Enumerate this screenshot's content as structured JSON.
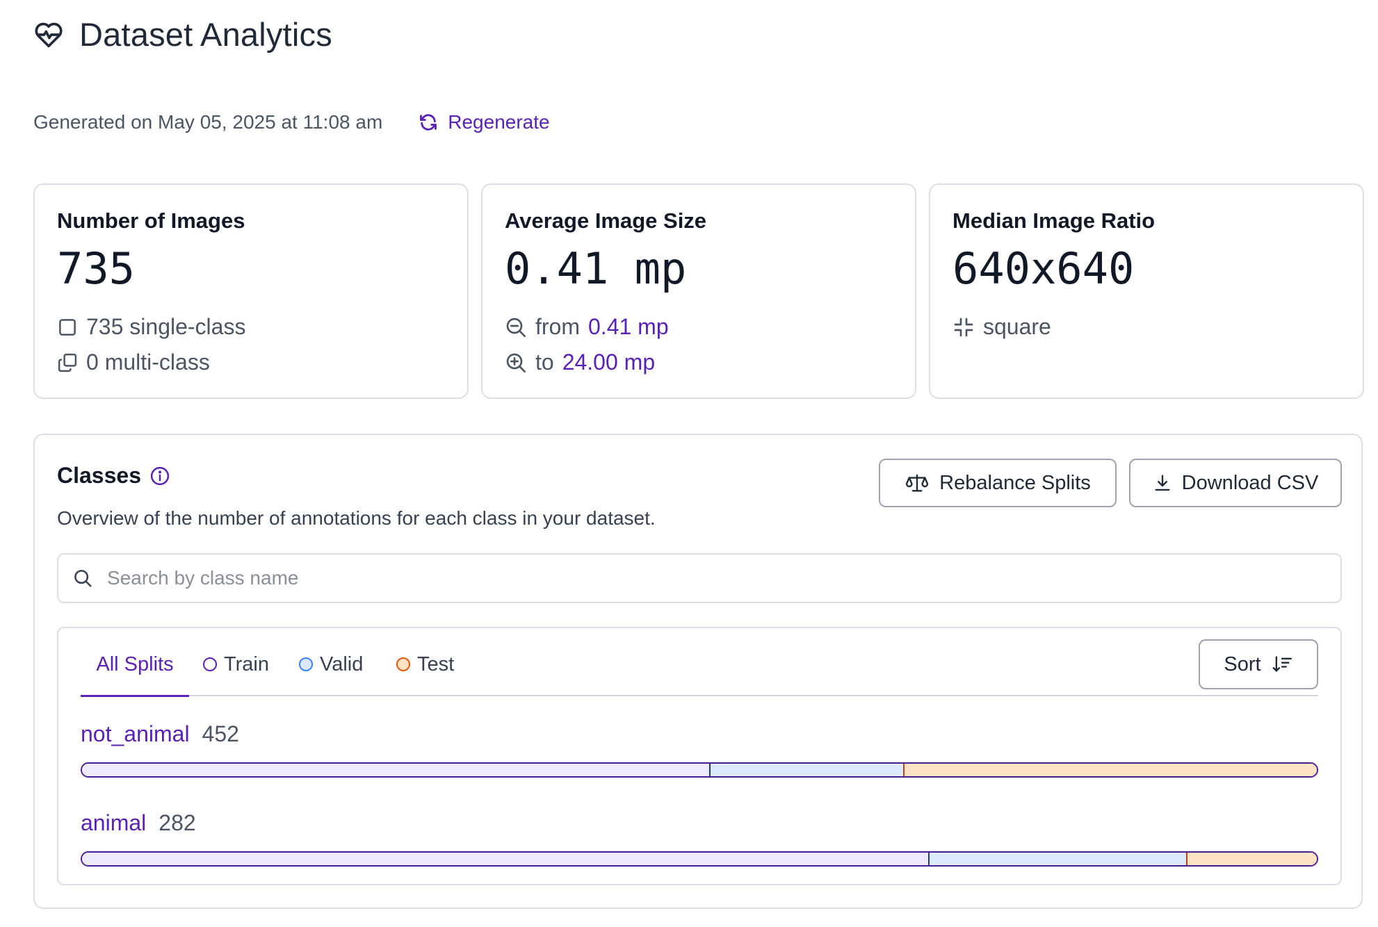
{
  "header": {
    "title": "Dataset Analytics",
    "icon": "heart-pulse-icon"
  },
  "generated": {
    "text": "Generated on May 05, 2025 at 11:08 am",
    "regenerate_label": "Regenerate"
  },
  "cards": {
    "images": {
      "title": "Number of Images",
      "value": "735",
      "single": "735 single-class",
      "multi": "0 multi-class"
    },
    "size": {
      "title": "Average Image Size",
      "value": "0.41 mp",
      "from_label": "from",
      "from_value": "0.41 mp",
      "to_label": "to",
      "to_value": "24.00 mp"
    },
    "ratio": {
      "title": "Median Image Ratio",
      "value": "640x640",
      "shape": "square"
    }
  },
  "classes": {
    "title": "Classes",
    "description": "Overview of the number of annotations for each class in your dataset.",
    "rebalance_label": "Rebalance Splits",
    "download_label": "Download CSV",
    "search_placeholder": "Search by class name",
    "tabs": [
      {
        "label": "All Splits"
      },
      {
        "label": "Train",
        "color": "#5b21b6"
      },
      {
        "label": "Valid",
        "color": "#3b82f6"
      },
      {
        "label": "Test",
        "color": "#ea580c"
      }
    ],
    "sort_label": "Sort",
    "rows": [
      {
        "name": "not_animal",
        "count": "452",
        "split": {
          "train": 0.508,
          "valid": 0.157,
          "test": 0.335
        }
      },
      {
        "name": "animal",
        "count": "282",
        "split": {
          "train": 0.685,
          "valid": 0.209,
          "test": 0.106
        }
      }
    ]
  },
  "colors": {
    "accent": "#5b21b6",
    "train": "#ede9fe",
    "valid": "#dbeafe",
    "test": "#fde2c4"
  }
}
